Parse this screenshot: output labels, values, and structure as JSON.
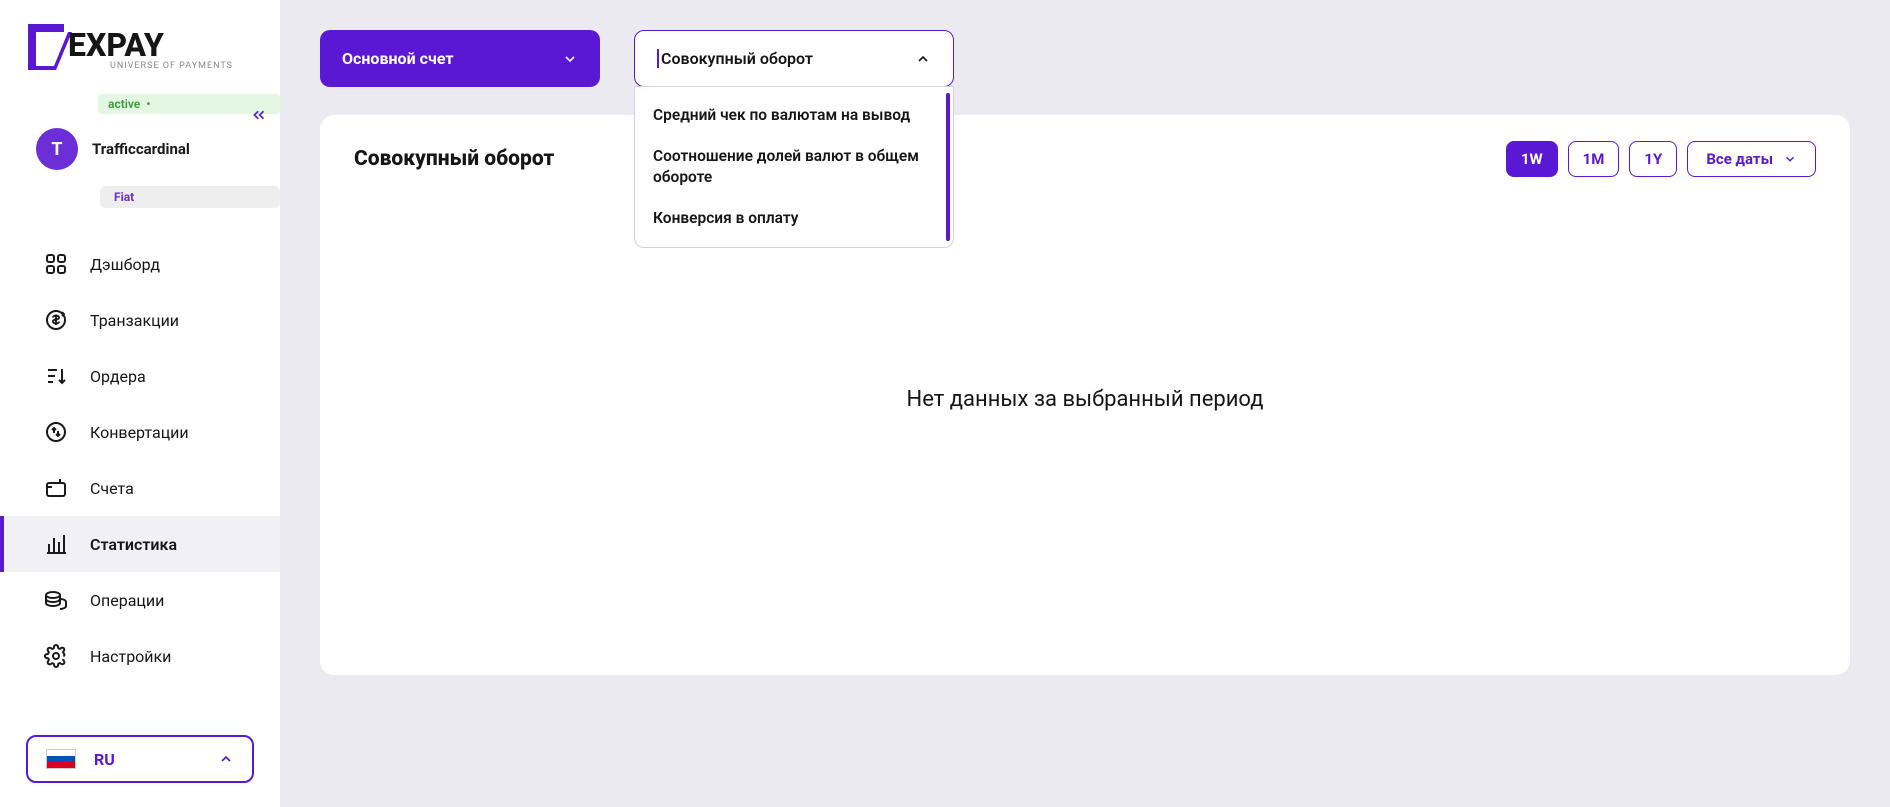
{
  "sidebar": {
    "logo_main": "EXPAY",
    "logo_sub": "UNIVERSE OF PAYMENTS",
    "status": "active",
    "avatar_letter": "T",
    "user_name": "Trafficcardinal",
    "account_type": "Fiat",
    "nav": [
      {
        "id": "dashboard",
        "label": "Дэшборд"
      },
      {
        "id": "transactions",
        "label": "Транзакции"
      },
      {
        "id": "orders",
        "label": "Ордера"
      },
      {
        "id": "convert",
        "label": "Конвертации"
      },
      {
        "id": "accounts",
        "label": "Счета"
      },
      {
        "id": "statistics",
        "label": "Статистика"
      },
      {
        "id": "operations",
        "label": "Операции"
      },
      {
        "id": "settings",
        "label": "Настройки"
      }
    ],
    "lang_label": "RU"
  },
  "selects": {
    "account_label": "Основной счет",
    "stat_label": "Совокупный оборот",
    "options": [
      "Средний чек по валютам на вывод",
      "Соотношение долей валют в общем обороте",
      "Конверсия в оплату"
    ]
  },
  "card": {
    "title": "Совокупный оборот",
    "ranges": [
      "1W",
      "1M",
      "1Y"
    ],
    "active_range": "1W",
    "all_dates_label": "Все даты",
    "empty_message": "Нет данных за выбранный период"
  }
}
